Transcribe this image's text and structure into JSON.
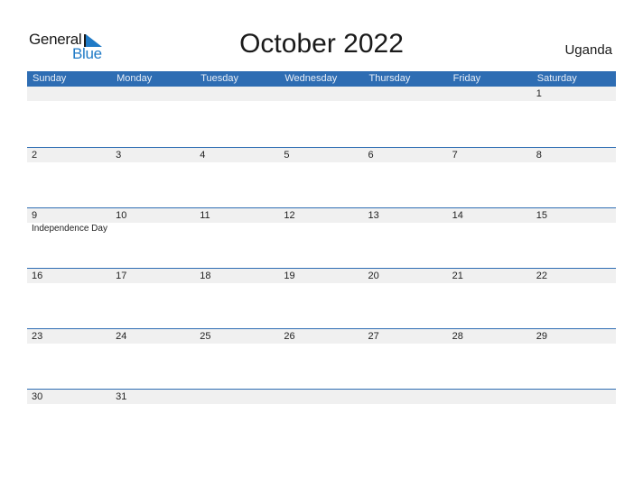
{
  "logo": {
    "general": "General",
    "blue": "Blue"
  },
  "title": "October 2022",
  "country": "Uganda",
  "weekdays": [
    "Sunday",
    "Monday",
    "Tuesday",
    "Wednesday",
    "Thursday",
    "Friday",
    "Saturday"
  ],
  "weeks": [
    {
      "days": [
        "",
        "",
        "",
        "",
        "",
        "",
        "1"
      ],
      "events": [
        "",
        "",
        "",
        "",
        "",
        "",
        ""
      ]
    },
    {
      "days": [
        "2",
        "3",
        "4",
        "5",
        "6",
        "7",
        "8"
      ],
      "events": [
        "",
        "",
        "",
        "",
        "",
        "",
        ""
      ]
    },
    {
      "days": [
        "9",
        "10",
        "11",
        "12",
        "13",
        "14",
        "15"
      ],
      "events": [
        "Independence Day",
        "",
        "",
        "",
        "",
        "",
        ""
      ]
    },
    {
      "days": [
        "16",
        "17",
        "18",
        "19",
        "20",
        "21",
        "22"
      ],
      "events": [
        "",
        "",
        "",
        "",
        "",
        "",
        ""
      ]
    },
    {
      "days": [
        "23",
        "24",
        "25",
        "26",
        "27",
        "28",
        "29"
      ],
      "events": [
        "",
        "",
        "",
        "",
        "",
        "",
        ""
      ]
    },
    {
      "days": [
        "30",
        "31",
        "",
        "",
        "",
        "",
        ""
      ],
      "events": [
        "",
        "",
        "",
        "",
        "",
        "",
        ""
      ]
    }
  ],
  "colors": {
    "header": "#2e6db3",
    "brand_blue": "#1f7ac6",
    "date_band": "#f0f0f0"
  }
}
